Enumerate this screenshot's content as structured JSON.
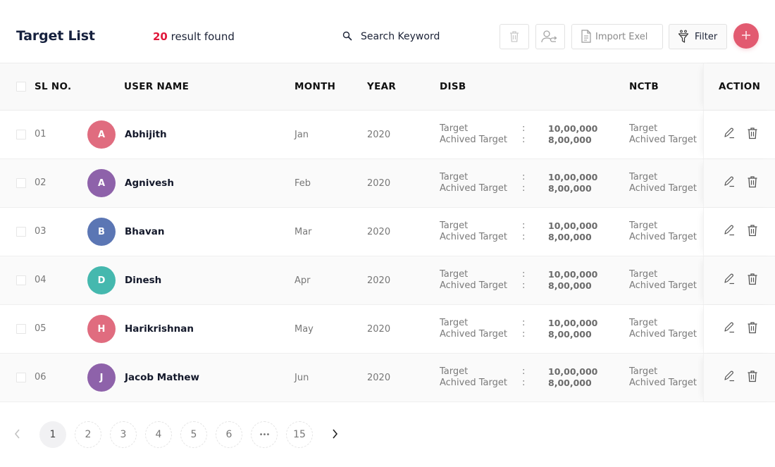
{
  "header": {
    "title": "Target List",
    "result_count": "20",
    "result_label": " result found",
    "search_placeholder": "Search Keyword",
    "import_label": "Import Exel",
    "filter_label": "Filter",
    "icons": {
      "search": "search-icon",
      "delete": "trash-icon",
      "assign": "user-assign-icon",
      "import": "document-icon",
      "filter": "funnel-icon",
      "add": "plus-icon"
    },
    "accent_color": "#e25a70",
    "count_color": "#e0173a"
  },
  "table": {
    "columns": {
      "sl": "SL NO.",
      "user": "USER NAME",
      "month": "MONTH",
      "year": "YEAR",
      "disb": "DISB",
      "nctb": "NCTB",
      "action": "ACTION"
    },
    "rows": [
      {
        "sl": "01",
        "initial": "A",
        "name": "Abhijith",
        "avatar_color": "#e06c7f",
        "month": "Jan",
        "year": "2020",
        "disb_target_label": "Target",
        "disb_achieved_label": "Achived Target",
        "disb_target": "10,00,000",
        "disb_achieved": "8,00,000",
        "nctb_target_label": "Target",
        "nctb_achieved_label": "Achived Target"
      },
      {
        "sl": "02",
        "initial": "A",
        "name": "Agnivesh",
        "avatar_color": "#8e62aa",
        "month": "Feb",
        "year": "2020",
        "disb_target_label": "Target",
        "disb_achieved_label": "Achived Target",
        "disb_target": "10,00,000",
        "disb_achieved": "8,00,000",
        "nctb_target_label": "Target",
        "nctb_achieved_label": "Achived Target"
      },
      {
        "sl": "03",
        "initial": "B",
        "name": "Bhavan",
        "avatar_color": "#5b76b4",
        "month": "Mar",
        "year": "2020",
        "disb_target_label": "Target",
        "disb_achieved_label": "Achived Target",
        "disb_target": "10,00,000",
        "disb_achieved": "8,00,000",
        "nctb_target_label": "Target",
        "nctb_achieved_label": "Achived Target"
      },
      {
        "sl": "04",
        "initial": "D",
        "name": "Dinesh",
        "avatar_color": "#45b8ae",
        "month": "Apr",
        "year": "2020",
        "disb_target_label": "Target",
        "disb_achieved_label": "Achived Target",
        "disb_target": "10,00,000",
        "disb_achieved": "8,00,000",
        "nctb_target_label": "Target",
        "nctb_achieved_label": "Achived Target"
      },
      {
        "sl": "05",
        "initial": "H",
        "name": "Harikrishnan",
        "avatar_color": "#e06c7f",
        "month": "May",
        "year": "2020",
        "disb_target_label": "Target",
        "disb_achieved_label": "Achived Target",
        "disb_target": "10,00,000",
        "disb_achieved": "8,00,000",
        "nctb_target_label": "Target",
        "nctb_achieved_label": "Achived Target"
      },
      {
        "sl": "06",
        "initial": "J",
        "name": "Jacob Mathew",
        "avatar_color": "#8e62aa",
        "month": "Jun",
        "year": "2020",
        "disb_target_label": "Target",
        "disb_achieved_label": "Achived Target",
        "disb_target": "10,00,000",
        "disb_achieved": "8,00,000",
        "nctb_target_label": "Target",
        "nctb_achieved_label": "Achived Target"
      }
    ],
    "separator": ":"
  },
  "pagination": {
    "pages": [
      "1",
      "2",
      "3",
      "4",
      "5",
      "6",
      "•••",
      "15"
    ],
    "current": "1"
  }
}
